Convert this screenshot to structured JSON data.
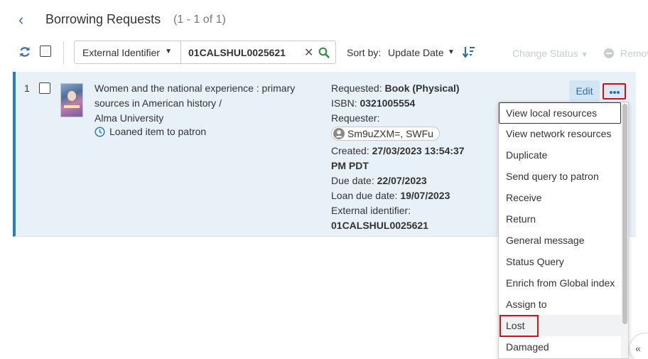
{
  "header": {
    "title": "Borrowing Requests",
    "count": "(1 - 1 of 1)"
  },
  "toolbar": {
    "filter_field": "External Identifier",
    "search_value": "01CALSHUL0025621",
    "sort_label": "Sort by:",
    "sort_value": "Update Date",
    "change_status_label": "Change Status",
    "remove_label": "Remove"
  },
  "row": {
    "number": "1",
    "title_lines": [
      "Women and the national experience : primary",
      "sources in American history /",
      "Alma University"
    ],
    "status": "Loaned item to patron",
    "details": {
      "requested_label": "Requested:",
      "requested_value": "Book (Physical)",
      "isbn_label": "ISBN:",
      "isbn_value": "0321005554",
      "requester_label": "Requester:",
      "requester_value": "Sm9uZXM=, SWFu",
      "created_label": "Created:",
      "created_value_1": "27/03/2023 13:54:37",
      "created_value_2": "PM PDT",
      "due_label": "Due date:",
      "due_value": "22/07/2023",
      "loan_due_label": "Loan due date:",
      "loan_due_value": "19/07/2023",
      "ext_id_label": "External identifier:",
      "ext_id_value": "01CALSHUL0025621"
    },
    "edit_label": "Edit"
  },
  "menu": {
    "items": [
      "View local resources",
      "View network resources",
      "Duplicate",
      "Send query to patron",
      "Receive",
      "Return",
      "General message",
      "Status Query",
      "Enrich from Global index",
      "Assign to",
      "Lost",
      "Damaged"
    ]
  },
  "colors": {
    "accent": "#2a7fb8",
    "row_bg": "#e8f0f8",
    "highlight_red": "#d0111b"
  },
  "icons": [
    "back-icon",
    "refresh-icon",
    "clear-icon",
    "search-icon",
    "sort-direction-icon",
    "remove-icon",
    "clock-icon",
    "person-icon",
    "more-icon",
    "double-chevron-left-icon"
  ]
}
